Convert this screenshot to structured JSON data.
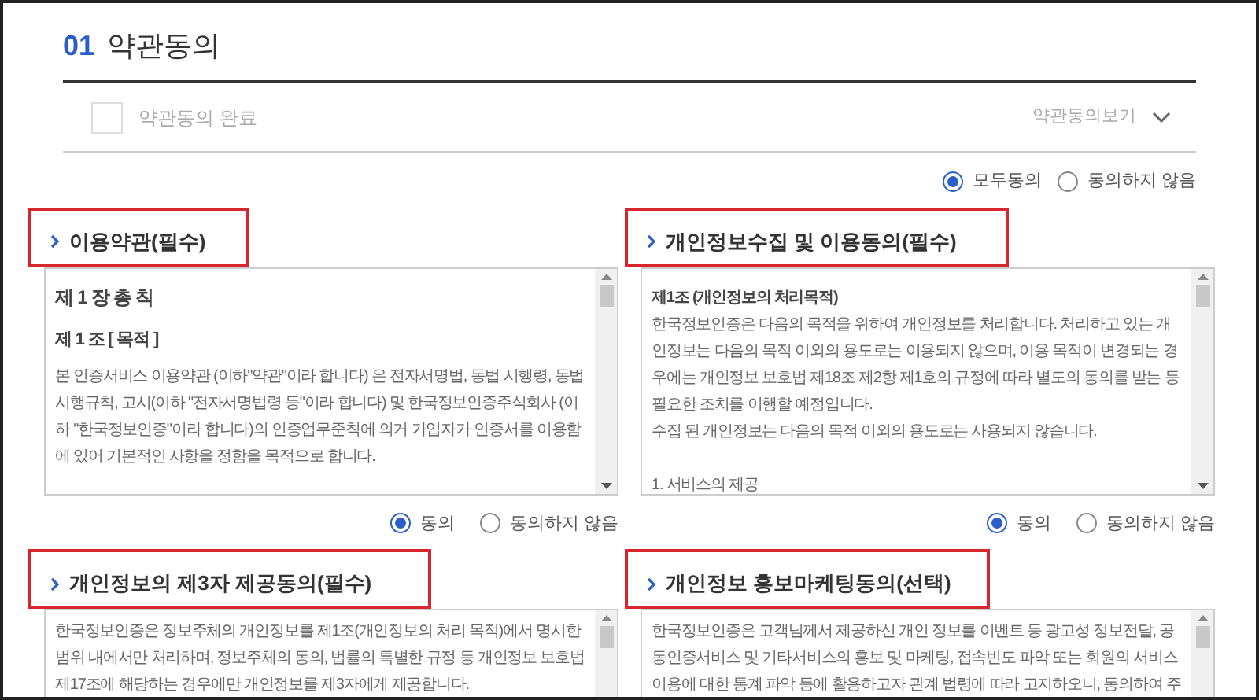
{
  "header": {
    "number": "01",
    "title": "약관동의"
  },
  "complete": {
    "label": "약관동의 완료",
    "checked": false
  },
  "view_toggle": {
    "label": "약관동의보기"
  },
  "all_options": [
    {
      "label": "모두동의",
      "selected": true
    },
    {
      "label": "동의하지 않음",
      "selected": false
    }
  ],
  "sections": [
    {
      "title": "이용약관(필수)",
      "highlighted": true,
      "paragraphs": [
        {
          "kind": "heading",
          "lines": [
            "제 1 장 총 칙"
          ]
        },
        {
          "kind": "subheading",
          "lines": [
            "제 1 조 [ 목적 ]"
          ]
        },
        {
          "kind": "body",
          "lines": [
            "본 인증서비스 이용약관 (이하\"약관\"이라 합니다) 은 전자서명법, 동법 시행령, 동법",
            "시행규칙, 고시(이하 \"전자서명법령 등\"이라 합니다) 및 한국정보인증주식회사 (이",
            "하 \"한국정보인증\"이라 합니다)의 인증업무준칙에 의거 가입자가 인증서를 이용함",
            "에 있어 기본적인 사항을 정함을 목적으로 합니다."
          ]
        }
      ],
      "options": [
        {
          "label": "동의",
          "selected": true
        },
        {
          "label": "동의하지 않음",
          "selected": false
        }
      ]
    },
    {
      "title": "개인정보수집 및 이용동의(필수)",
      "highlighted": true,
      "paragraphs": [
        {
          "kind": "title",
          "lines": [
            "제1조 (개인정보의 처리목적)"
          ]
        },
        {
          "kind": "body",
          "lines": [
            "한국정보인증은 다음의 목적을 위하여 개인정보를 처리합니다. 처리하고 있는 개",
            "인정보는 다음의 목적 이외의 용도로는 이용되지 않으며, 이용 목적이 변경되는 경",
            "우에는 개인정보 보호법 제18조 제2항 제1호의 규정에 따라 별도의 동의를 받는 등",
            "필요한 조치를 이행할 예정입니다.",
            "수집 된 개인정보는 다음의 목적 이외의 용도로는 사용되지 않습니다."
          ]
        },
        {
          "kind": "item",
          "lines": [
            "1. 서비스의 제공"
          ]
        }
      ],
      "options": [
        {
          "label": "동의",
          "selected": true
        },
        {
          "label": "동의하지 않음",
          "selected": false
        }
      ]
    },
    {
      "title": "개인정보의 제3자 제공동의(필수)",
      "highlighted": true,
      "paragraphs": [
        {
          "kind": "body",
          "lines": [
            "한국정보인증은 정보주체의 개인정보를 제1조(개인정보의 처리 목적)에서 명시한",
            "범위 내에서만 처리하며, 정보주체의 동의, 법률의 특별한 규정 등 개인정보 보호법",
            "제17조에 해당하는 경우에만 개인정보를 제3자에게 제공합니다."
          ]
        }
      ]
    },
    {
      "title": "개인정보 홍보마케팅동의(선택)",
      "highlighted": true,
      "paragraphs": [
        {
          "kind": "body",
          "lines": [
            "한국정보인증은 고객님께서 제공하신 개인 정보를 이벤트 등 광고성 정보전달, 공",
            "동인증서비스 및 기타서비스의 홍보 및 마케팅, 접속빈도 파악 또는 회원의 서비스",
            "이용에 대한 통계 파악 등에 활용하고자 관계 법령에 따라 고지하오니, 동의하여 주"
          ]
        }
      ]
    }
  ]
}
